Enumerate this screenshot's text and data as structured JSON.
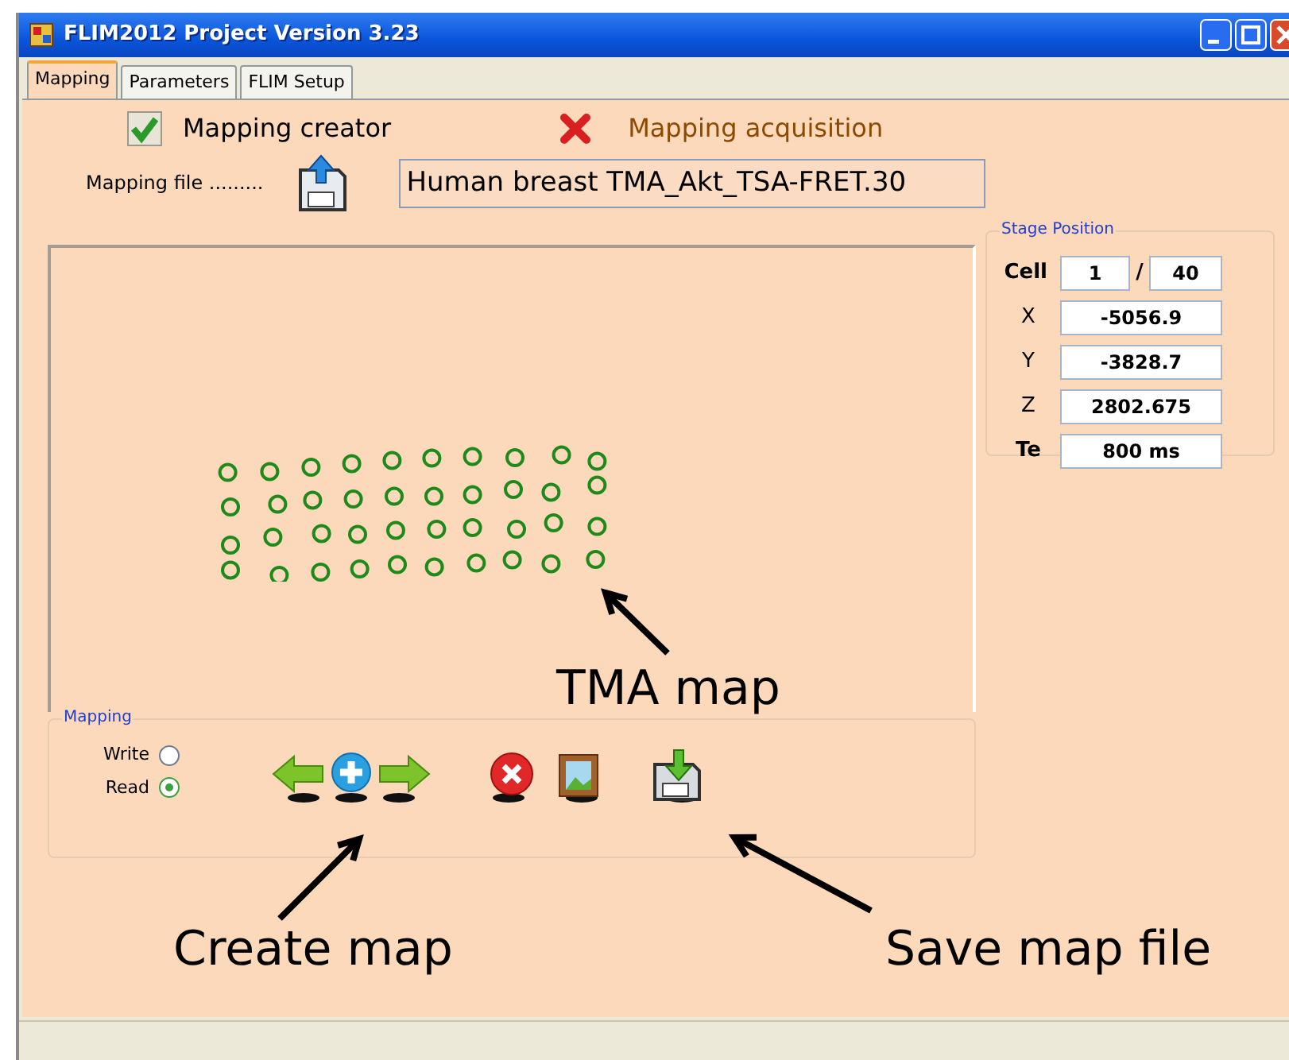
{
  "window": {
    "title": "FLIM2012 Project Version 3.23"
  },
  "tabs": [
    {
      "label": "Mapping",
      "selected": true
    },
    {
      "label": "Parameters",
      "selected": false
    },
    {
      "label": "FLIM Setup",
      "selected": false
    }
  ],
  "mapping_status": [
    {
      "label": "Mapping creator",
      "kind": "check"
    },
    {
      "label": "Mapping acquisition",
      "kind": "cross"
    }
  ],
  "mapping_file": {
    "label": "Mapping file .........",
    "value": "Human breast TMA_Akt_TSA-FRET.30"
  },
  "stage_position": {
    "title": "Stage Position",
    "cell": {
      "label": "Cell",
      "value": "1",
      "separator": "/",
      "total": "40"
    },
    "fields": [
      {
        "label": "X",
        "value": "-5056.9"
      },
      {
        "label": "Y",
        "value": "-3828.7"
      },
      {
        "label": "Z",
        "value": "2802.675"
      },
      {
        "label": "Te",
        "value": "800 ms"
      }
    ]
  },
  "mapping": {
    "title": "Mapping",
    "modes": [
      {
        "label": "Write",
        "selected": false
      },
      {
        "label": "Read",
        "selected": true
      }
    ]
  },
  "annotations": [
    "TMA map",
    "Create map",
    "Save map file"
  ]
}
